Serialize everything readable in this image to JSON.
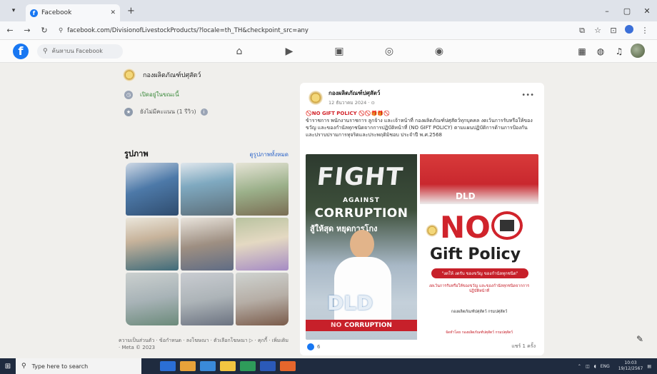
{
  "browser": {
    "tab_title": "Facebook",
    "tab_close": "✕",
    "new_tab": "+",
    "url": "facebook.com/DivisionofLivestockProducts/?locale=th_TH&checkpoint_src=any",
    "window_controls": [
      "–",
      "▢",
      "✕"
    ]
  },
  "fb_header": {
    "search_placeholder": "ค้นหาบน Facebook",
    "nav_icons": [
      "home-icon",
      "video-icon",
      "marketplace-icon",
      "groups-icon",
      "gaming-icon"
    ],
    "right_icons": [
      "menu-grid-icon",
      "messenger-icon",
      "notifications-icon"
    ]
  },
  "left": {
    "page_name": "กองผลิตภัณฑ์ปศุสัตว์",
    "status": "เปิดอยู่ในขณะนี้",
    "rating": "ยังไม่มีคะแนน (1 รีวิว)",
    "photos_title": "รูปภาพ",
    "photos_link": "ดูรูปภาพทั้งหมด",
    "footer": "ความเป็นส่วนตัว · ข้อกำหนด · ลงโฆษณา · ตัวเลือกโฆษณา ▷ · คุกกี้ · เพิ่มเติม · Meta © 2023"
  },
  "post": {
    "author": "กองผลิตภัณฑ์ปศุสัตว์",
    "date": "12 ธันวาคม 2024 · ⊙",
    "headline": "🚫NO GIFT POLICY 🚫🚫🎁🎁🚫",
    "body": "ข้าราชการ พนักงานราชการ ลูกจ้าง และเจ้าหน้าที่ กองผลิตภัณฑ์ปศุสัตว์ทุกบุคคล งดเว้นการรับหรือให้ของขวัญ และของกำนัลทุกชนิดจากการปฏิบัติหน้าที่ (NO GIFT POLICY) ตามแผนปฏิบัติการด้านการป้องกันและปราบปรามการทุจริตและประพฤติมิชอบ ประจำปี พ.ศ.2568",
    "image": {
      "fight": "FIGHT",
      "against": "AGAINST",
      "corruption": "CORRUPTION",
      "thai_slogan": "สู้ให้สุด หยุดการโกง",
      "dld": "DLD",
      "no_corruption": "CORRUPTION",
      "no_prefix": "NO",
      "dld_right": "DLD",
      "no_big": "NO",
      "gift_policy": "Gift Policy",
      "slogan": "\"งดให้ งดรับ ของขวัญ ของกำนัลทุกชนิด\"",
      "fine_red": "งดเว้นการรับหรือให้ของขวัญ และของกำนัลทุกชนิดจากการปฏิบัติหน้าที่",
      "fine_dark": "กองผลิตภัณฑ์ปศุสัตว์ กรมปศุสัตว์",
      "fine_foot": "จัดทำโดย กองผลิตภัณฑ์ปศุสัตว์ กรมปศุสัตว์"
    },
    "likes": "6",
    "shares": "แชร์ 1 ครั้ง"
  },
  "taskbar": {
    "search_placeholder": "Type here to search",
    "lang": "ENG",
    "time": "10:03",
    "date": "19/12/2567"
  }
}
